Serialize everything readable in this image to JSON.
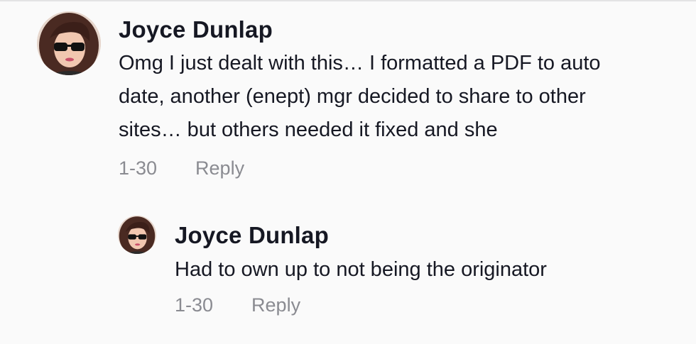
{
  "comments": [
    {
      "username": "Joyce Dunlap",
      "text_lines": [
        "Omg I just dealt with this… I formatted a PDF to auto",
        "date, another (enept) mgr decided to share to other",
        "sites… but others needed it fixed and she"
      ],
      "date": "1-30",
      "reply_label": "Reply"
    },
    {
      "username": "Joyce Dunlap",
      "text_lines": [
        "Had to own up to not being the originator"
      ],
      "date": "1-30",
      "reply_label": "Reply"
    }
  ],
  "colors": {
    "background": "#fafafa",
    "text": "#161823",
    "meta": "#8a8b91",
    "divider": "#e3e3e4"
  },
  "icons": {
    "avatar": "user-avatar-sunglasses"
  }
}
